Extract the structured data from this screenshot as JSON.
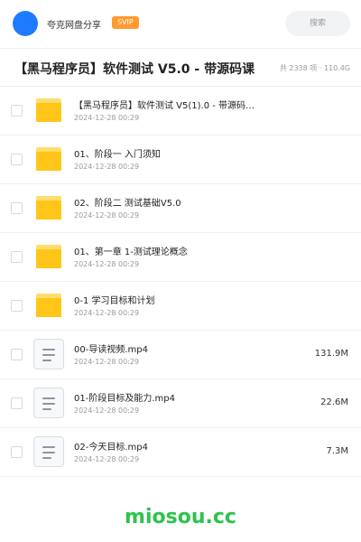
{
  "header": {
    "username": "夸克网盘分享",
    "badge": "SVIP",
    "search_placeholder": "搜索",
    "colors": {
      "avatar": "#1e7bff",
      "badge": "#ff9a2e"
    }
  },
  "folder": {
    "title": "【黑马程序员】软件测试 V5.0 - 带源码课",
    "count_label": "共 2338 项 · 110.4G"
  },
  "files": [
    {
      "type": "folder",
      "icon": "folder-icon",
      "name": "【黑马程序员】软件测试 V5(1).0 - 带源码…",
      "date": "2024-12-28 00:29",
      "size": ""
    },
    {
      "type": "folder",
      "icon": "folder-icon",
      "name": "01、阶段一 入门须知",
      "date": "2024-12-28 00:29",
      "size": ""
    },
    {
      "type": "folder",
      "icon": "folder-icon",
      "name": "02、阶段二 测试基础V5.0",
      "date": "2024-12-28 00:29",
      "size": ""
    },
    {
      "type": "folder",
      "icon": "folder-icon",
      "name": "01、第一章 1-测试理论概念",
      "date": "2024-12-28 00:29",
      "size": ""
    },
    {
      "type": "folder",
      "icon": "folder-icon",
      "name": "0-1 学习目标和计划",
      "date": "2024-12-28 00:29",
      "size": ""
    },
    {
      "type": "file",
      "icon": "document-icon",
      "name": "00-导读视频.mp4",
      "date": "2024-12-28 00:29",
      "size": "131.9M"
    },
    {
      "type": "file",
      "icon": "document-icon",
      "name": "01-阶段目标及能力.mp4",
      "date": "2024-12-28 00:29",
      "size": "22.6M"
    },
    {
      "type": "file",
      "icon": "document-icon",
      "name": "02-今天目标.mp4",
      "date": "2024-12-28 00:29",
      "size": "7.3M"
    }
  ],
  "watermark": "miosou.cc",
  "colors": {
    "folder": "#ffc519",
    "watermark": "#2ec24d"
  }
}
